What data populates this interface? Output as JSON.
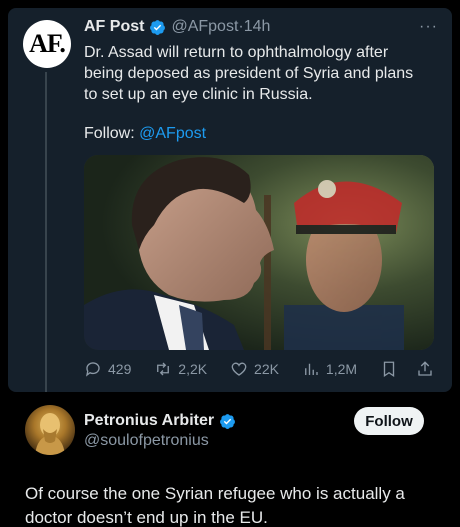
{
  "post": {
    "avatar_text": "AF.",
    "author_name": "AF Post",
    "author_handle": "@AFpost",
    "separator": "·",
    "time": "14h",
    "more": "···",
    "text": "Dr. Assad will return to ophthalmology after being deposed as president of Syria and plans to set up an eye clinic in Russia.",
    "follow_prefix": "Follow: ",
    "follow_handle": "@AFpost",
    "actions": {
      "replies": "429",
      "reposts": "2,2K",
      "likes": "22K",
      "views": "1,2M"
    }
  },
  "reply": {
    "author_name": "Petronius Arbiter",
    "author_handle": "@soulofpetronius",
    "follow_label": "Follow",
    "text": "Of course the one Syrian refugee who is actually a doctor doesn’t end up in the EU."
  },
  "colors": {
    "card_bg": "#15202b",
    "accent": "#1d9bf0",
    "muted": "#8b98a5",
    "text": "#e7e9ea"
  }
}
